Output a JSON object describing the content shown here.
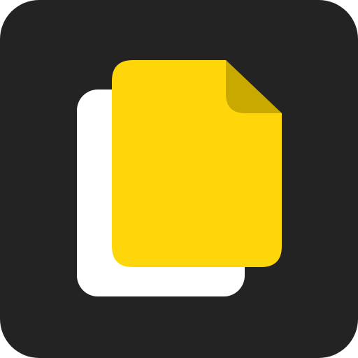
{
  "icon": {
    "name": "copy-file-app-icon",
    "glyph": "copy-files-icon",
    "colors": {
      "background": "#232323",
      "back_sheet": "#ffffff",
      "front_sheet": "#ffd60a",
      "folded_corner": "#c9a800"
    }
  }
}
